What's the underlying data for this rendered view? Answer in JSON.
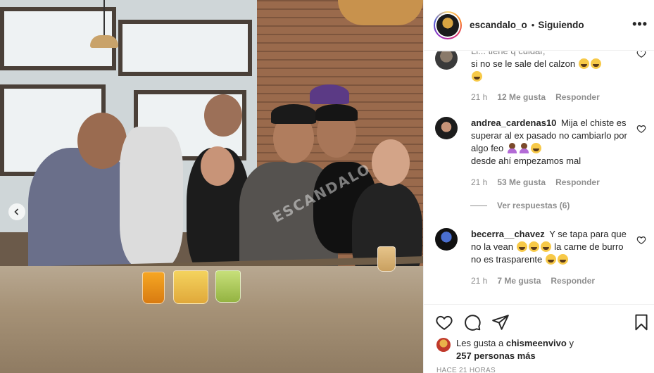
{
  "post": {
    "username": "escandalo_o",
    "separator": "•",
    "follow_status": "Siguiendo",
    "more_label": "•••",
    "media_watermark": "ESCANDALO"
  },
  "comments": [
    {
      "username": "",
      "text": "... si no se le sale del calzon",
      "first_line": "Li... tiene q cuidar,",
      "time": "21 h",
      "likes": "12 Me gusta",
      "reply": "Responder"
    },
    {
      "username": "andrea_cardenas10",
      "text": "Mija el chiste es superar al ex pasado no cambiarlo por algo feo",
      "text2": "desde ahí empezamos mal",
      "time": "21 h",
      "likes": "53 Me gusta",
      "reply": "Responder",
      "replies_label": "Ver respuestas (6)"
    },
    {
      "username": "becerra__chavez",
      "text": "Y se tapa para que no la vean",
      "text2": "la carne de burro no es trasparente",
      "time": "21 h",
      "likes": "7 Me gusta",
      "reply": "Responder"
    }
  ],
  "likes": {
    "prefix": "Les gusta a",
    "user": "chismeenvivo",
    "connector": "y",
    "others": "257 personas más"
  },
  "timestamp": "HACE 21 HORAS",
  "icons": [
    "heart-icon",
    "comment-icon",
    "share-icon",
    "bookmark-icon",
    "more-options-icon",
    "chevron-left-icon"
  ],
  "colors": {
    "text": "#262626",
    "secondary": "#8e8e8e",
    "border": "#efefef"
  }
}
